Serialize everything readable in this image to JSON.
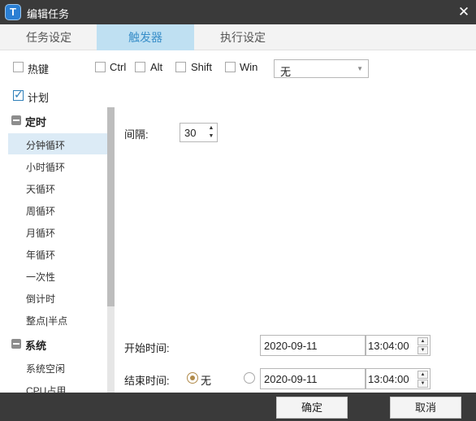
{
  "window": {
    "title": "编辑任务",
    "close_glyph": "✕",
    "app_icon_glyph": "T"
  },
  "tabs": [
    {
      "label": "任务设定",
      "active": false
    },
    {
      "label": "触发器",
      "active": true
    },
    {
      "label": "执行设定",
      "active": false
    }
  ],
  "hotkey": {
    "label": "热键",
    "checked": false,
    "modifiers": [
      {
        "label": "Ctrl",
        "checked": false
      },
      {
        "label": "Alt",
        "checked": false
      },
      {
        "label": "Shift",
        "checked": false
      },
      {
        "label": "Win",
        "checked": false
      }
    ],
    "key_select": {
      "value": "无"
    }
  },
  "plan": {
    "label": "计划",
    "checked": true
  },
  "schedule_list": {
    "groups": [
      {
        "label": "定时",
        "items": [
          "分钟循环",
          "小时循环",
          "天循环",
          "周循环",
          "月循环",
          "年循环",
          "一次性",
          "倒计时",
          "整点|半点"
        ],
        "selected_index": 0
      },
      {
        "label": "系统",
        "items": [
          "系统空闲",
          "CPU占用"
        ]
      }
    ]
  },
  "interval": {
    "label": "间隔:",
    "value": "30"
  },
  "start_time": {
    "label": "开始时间:",
    "date": "2020-09-11",
    "time": "13:04:00"
  },
  "end_time": {
    "label": "结束时间:",
    "none_label": "无",
    "none_selected": true,
    "date": "2020-09-11",
    "time": "13:04:00"
  },
  "buttons": {
    "ok": "确定",
    "cancel": "取消"
  },
  "colors": {
    "titlebar": "#3a3a3a",
    "active_tab": "#bfe0f2",
    "active_tab_text": "#3a8fc9",
    "selected_item": "#dcebf6"
  }
}
